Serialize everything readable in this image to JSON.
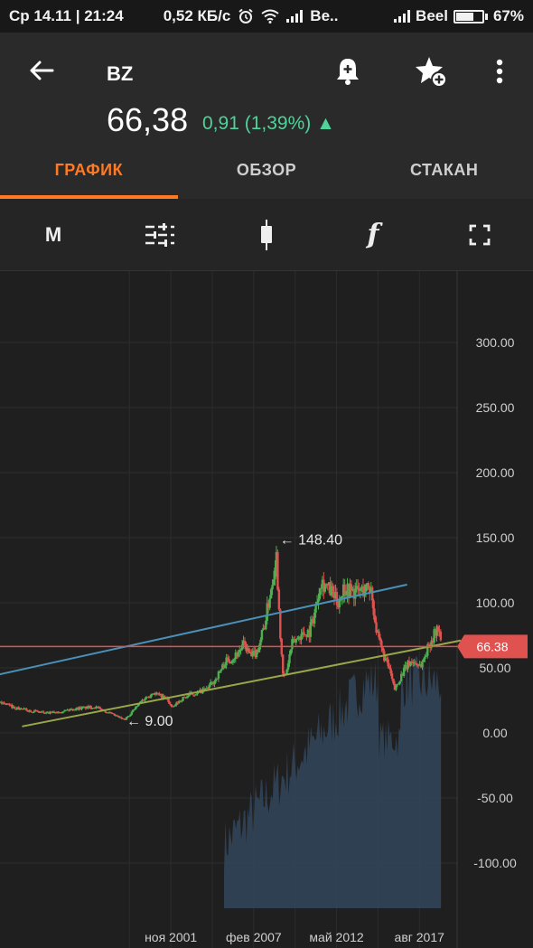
{
  "status": {
    "day_date": "Ср 14.11",
    "time": "21:24",
    "net_speed": "0,52 КБ/с",
    "carrier1": "Be..",
    "carrier2": "Beel",
    "battery": "67%",
    "battery_level": 0.67
  },
  "header": {
    "ticker": "BZ",
    "price": "66,38",
    "change": "0,91 (1,39%) ▲"
  },
  "tabs": [
    {
      "label": "ГРАФИК",
      "active": true
    },
    {
      "label": "ОБЗОР",
      "active": false
    },
    {
      "label": "СТАКАН",
      "active": false
    }
  ],
  "toolbar": {
    "interval_label": "M",
    "function_label": "f"
  },
  "colors": {
    "up": "#4caf50",
    "down": "#e0524f",
    "accent": "#ff7a22",
    "price_line": "#e0524f",
    "resistance_line": "#4a90b8",
    "support_line": "#9aa64a",
    "volume": "#33465c"
  },
  "chart_data": {
    "type": "candlestick",
    "ylim": [
      -130,
      340
    ],
    "y_ticks": [
      300,
      250,
      200,
      150,
      100,
      50,
      0,
      -50,
      -100
    ],
    "y_tick_labels": [
      "300.00",
      "250.00",
      "200.00",
      "150.00",
      "100.00",
      "50.00",
      "0.00",
      "-50.00",
      "-100.00"
    ],
    "x_ticks": [
      "ноя 2001",
      "фев 2007",
      "май 2012",
      "авг 2017"
    ],
    "x_tick_positions": [
      2001.83,
      2007.08,
      2012.33,
      2017.58
    ],
    "xlim": [
      1990.6,
      2020.2
    ],
    "current_price": 66.38,
    "current_price_label": "66.38",
    "max_label": "← 148.40",
    "max_point": [
      2008.5,
      148.4
    ],
    "min_label": "← 9.00",
    "min_point": [
      1998.9,
      9.0
    ],
    "resistance_line": [
      [
        1990.6,
        44
      ],
      [
        2016.8,
        114
      ]
    ],
    "support_line": [
      [
        1992.4,
        5
      ],
      [
        2020.2,
        71
      ]
    ],
    "monthly_close_anchors": [
      [
        1990.6,
        22
      ],
      [
        1991.0,
        24
      ],
      [
        1992.0,
        19
      ],
      [
        1993.0,
        17
      ],
      [
        1994.0,
        15
      ],
      [
        1995.0,
        17
      ],
      [
        1996.0,
        19
      ],
      [
        1997.0,
        20
      ],
      [
        1997.8,
        16
      ],
      [
        1998.9,
        10
      ],
      [
        1999.5,
        18
      ],
      [
        2000.0,
        25
      ],
      [
        2000.7,
        31
      ],
      [
        2001.6,
        26
      ],
      [
        2001.9,
        19
      ],
      [
        2002.5,
        26
      ],
      [
        2003.0,
        29
      ],
      [
        2004.0,
        33
      ],
      [
        2004.6,
        40
      ],
      [
        2005.3,
        55
      ],
      [
        2005.8,
        58
      ],
      [
        2006.5,
        68
      ],
      [
        2006.9,
        58
      ],
      [
        2007.3,
        63
      ],
      [
        2007.8,
        85
      ],
      [
        2008.3,
        120
      ],
      [
        2008.5,
        140
      ],
      [
        2008.9,
        45
      ],
      [
        2009.1,
        44
      ],
      [
        2009.5,
        68
      ],
      [
        2010.0,
        75
      ],
      [
        2010.6,
        78
      ],
      [
        2011.0,
        95
      ],
      [
        2011.3,
        118
      ],
      [
        2012.0,
        108
      ],
      [
        2012.4,
        100
      ],
      [
        2012.8,
        112
      ],
      [
        2013.5,
        108
      ],
      [
        2014.0,
        110
      ],
      [
        2014.5,
        112
      ],
      [
        2014.9,
        75
      ],
      [
        2015.3,
        60
      ],
      [
        2015.7,
        48
      ],
      [
        2016.0,
        33
      ],
      [
        2016.5,
        46
      ],
      [
        2017.0,
        55
      ],
      [
        2017.7,
        52
      ],
      [
        2018.2,
        68
      ],
      [
        2018.8,
        82
      ],
      [
        2018.95,
        66.38
      ]
    ],
    "volume_series_start": 2005.2
  }
}
